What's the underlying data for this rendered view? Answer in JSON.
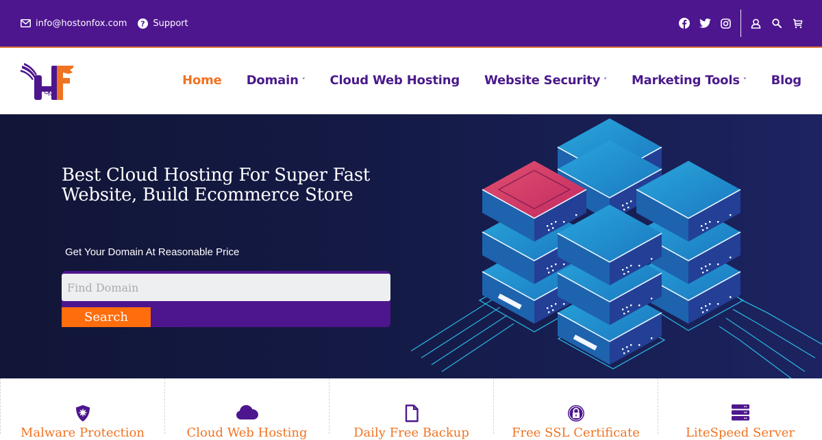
{
  "topbar": {
    "email": "info@hostonfox.com",
    "support_label": "Support",
    "social_icons": [
      "facebook-icon",
      "twitter-icon",
      "instagram-icon"
    ],
    "tool_icons": [
      "user-icon",
      "search-icon",
      "cart-icon"
    ]
  },
  "brand": {
    "logo_alt": "HostOnFox",
    "primary_color": "#4d168e",
    "accent_color": "#f07322"
  },
  "nav": {
    "items": [
      {
        "label": "Home",
        "active": true,
        "dropdown": false
      },
      {
        "label": "Domain",
        "active": false,
        "dropdown": true
      },
      {
        "label": "Cloud Web Hosting",
        "active": false,
        "dropdown": false
      },
      {
        "label": "Website Security",
        "active": false,
        "dropdown": true
      },
      {
        "label": "Marketing Tools",
        "active": false,
        "dropdown": true
      },
      {
        "label": "Blog",
        "active": false,
        "dropdown": false
      }
    ],
    "chevron": "⌄"
  },
  "hero": {
    "title": "Best Cloud Hosting For Super Fast Website, Build Ecommerce Store",
    "subtitle": "Get Your Domain At Reasonable Price",
    "search_placeholder": "Find Domain",
    "search_value": "",
    "search_button": "Search"
  },
  "features": [
    {
      "label": "Malware Protection",
      "icon": "shield-virus-icon"
    },
    {
      "label": "Cloud Web Hosting",
      "icon": "cloud-icon"
    },
    {
      "label": "Daily Free Backup",
      "icon": "file-icon"
    },
    {
      "label": "Free SSL Certificate",
      "icon": "lock-icon"
    },
    {
      "label": "LiteSpeed Server",
      "icon": "server-icon"
    }
  ]
}
